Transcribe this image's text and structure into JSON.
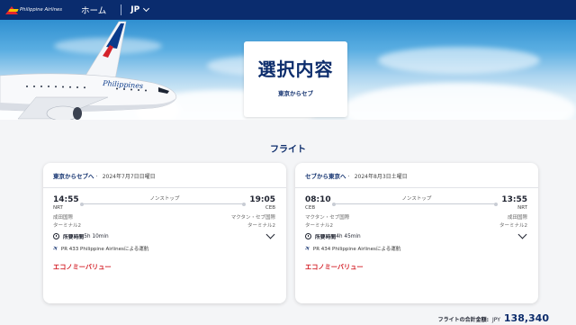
{
  "header": {
    "logo_text": "Philippine Airlines",
    "home_label": "ホーム",
    "lang_label": "JP"
  },
  "hero": {
    "title": "選択内容",
    "subtitle": "東京からセブ",
    "plane_livery": "Philippines"
  },
  "section_title": "フライト",
  "flights": [
    {
      "route": "東京からセブへ",
      "date": "2024年7月7日日曜日",
      "nonstop": "ノンストップ",
      "dep_time": "14:55",
      "arr_time": "19:05",
      "dep_code": "NRT",
      "arr_code": "CEB",
      "dep_airport": "成田国際",
      "arr_airport": "マクタン・セブ国際",
      "dep_terminal": "ターミナル2",
      "arr_terminal": "ターミナル2",
      "duration_label": "所要時間",
      "duration": "5h 10min",
      "operator": "PR 433 Philippine Airlinesによる運航",
      "fare": "エコノミーバリュー"
    },
    {
      "route": "セブから東京へ",
      "date": "2024年8月3日土曜日",
      "nonstop": "ノンストップ",
      "dep_time": "08:10",
      "arr_time": "13:55",
      "dep_code": "CEB",
      "arr_code": "NRT",
      "dep_airport": "マクタン・セブ国際",
      "arr_airport": "成田国際",
      "dep_terminal": "ターミナル2",
      "arr_terminal": "ターミナル2",
      "duration_label": "所要時間",
      "duration": "4h 45min",
      "operator": "PR 434 Philippine Airlinesによる運航",
      "fare": "エコノミーバリュー"
    }
  ],
  "total": {
    "label": "フライトの合計金額:",
    "currency": "JPY",
    "amount": "138,340"
  },
  "colors": {
    "nav_bg": "#0a2c6e",
    "brand_blue": "#0d2d6c",
    "fare_red": "#d4222a"
  },
  "icons": {
    "logo": "philippine-airlines-logo",
    "lang_dropdown": "chevron-down-icon",
    "duration": "clock-icon",
    "operator": "plane-icon",
    "expand": "chevron-down-icon"
  }
}
